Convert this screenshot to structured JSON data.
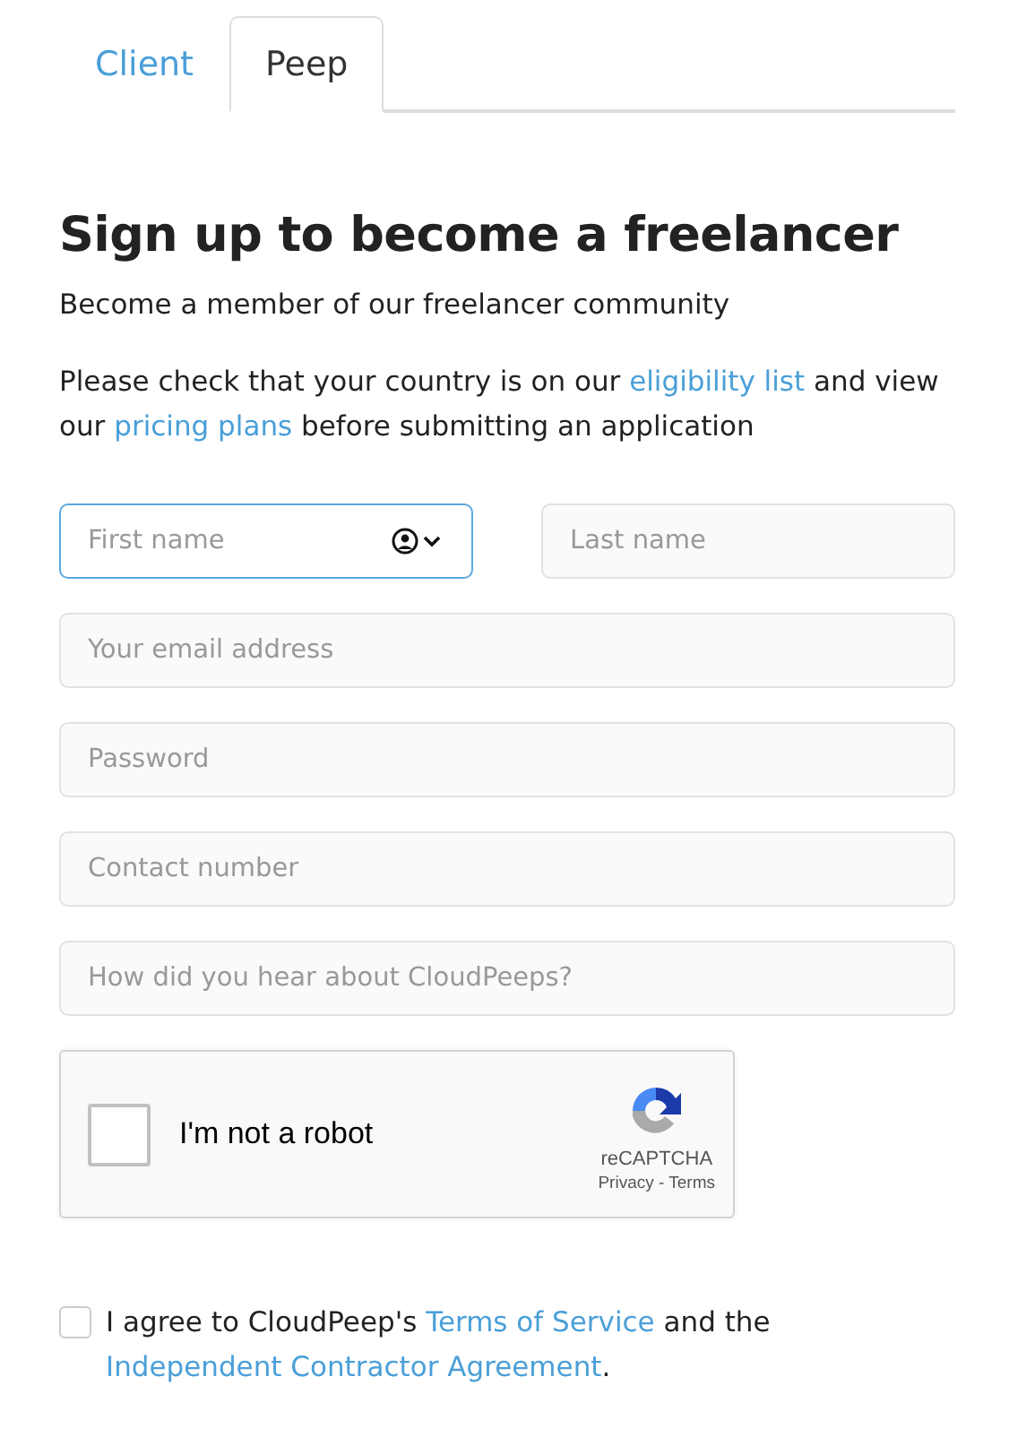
{
  "tabs": [
    {
      "label": "Client",
      "selected": false
    },
    {
      "label": "Peep",
      "selected": true
    }
  ],
  "heading": "Sign up to become a freelancer",
  "subheading": "Become a member of our freelancer community",
  "notice": [
    {
      "kind": "text",
      "text": "Please check that your country is on our "
    },
    {
      "kind": "link",
      "text": "eligibility list"
    },
    {
      "kind": "text",
      "text": " and view our "
    },
    {
      "kind": "link",
      "text": "pricing plans"
    },
    {
      "kind": "text",
      "text": " before submitting an application"
    }
  ],
  "name_fields": [
    {
      "placeholder": "First name",
      "focused": true,
      "autofill": true
    },
    {
      "placeholder": "Last name",
      "focused": false,
      "autofill": false
    }
  ],
  "fields": [
    {
      "placeholder": "Your email address",
      "focused": false
    },
    {
      "placeholder": "Password",
      "focused": false
    },
    {
      "placeholder": "Contact number",
      "focused": false
    },
    {
      "placeholder": "How did you hear about CloudPeeps?",
      "focused": false
    }
  ],
  "captcha": {
    "label": "I'm not a robot",
    "checked": false,
    "brand": "reCAPTCHA",
    "links": "Privacy - Terms"
  },
  "agreement": {
    "checked": false,
    "parts": [
      {
        "kind": "text",
        "text": "I agree to CloudPeep's "
      },
      {
        "kind": "link",
        "text": "Terms of Service"
      },
      {
        "kind": "text",
        "text": " and the "
      },
      {
        "kind": "link",
        "text": "Independent Contractor Agreement"
      },
      {
        "kind": "text",
        "text": "."
      }
    ]
  }
}
